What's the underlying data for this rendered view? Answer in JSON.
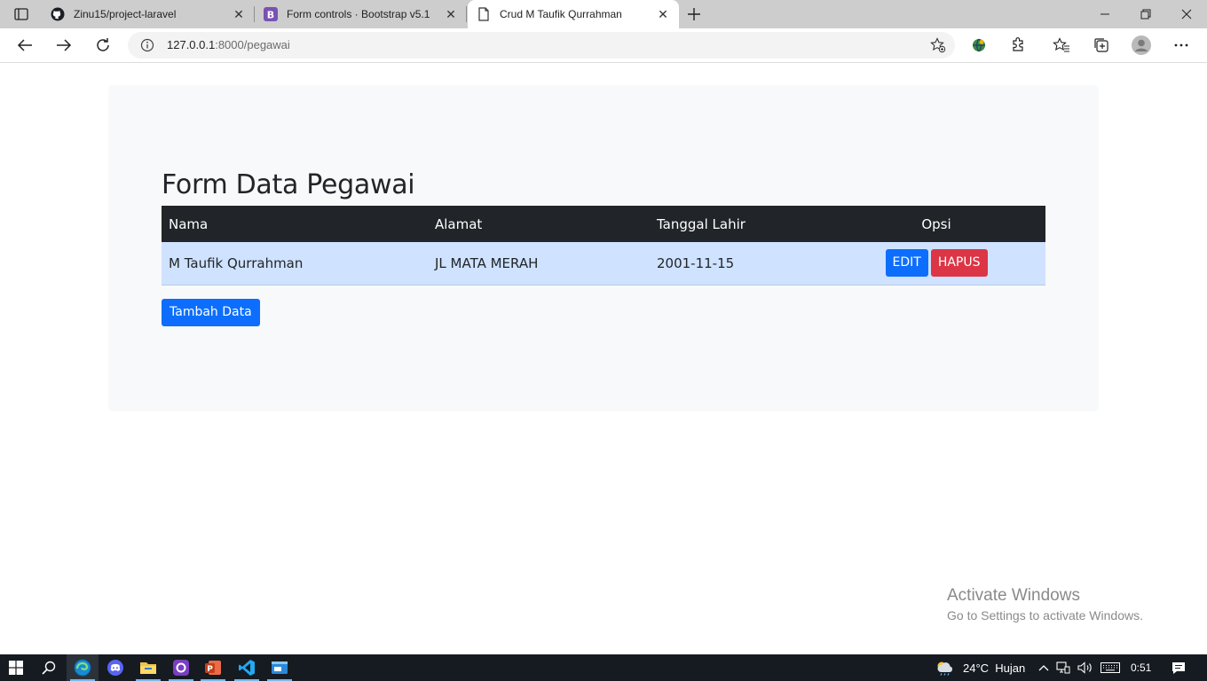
{
  "browser": {
    "tabs": [
      {
        "title": "Zinu15/project-laravel",
        "favicon": "github-icon"
      },
      {
        "title": "Form controls · Bootstrap v5.1",
        "favicon": "bootstrap-icon"
      },
      {
        "title": "Crud M Taufik Qurrahman",
        "favicon": "page-icon",
        "active": true
      }
    ],
    "address": {
      "host": "127.0.0.1",
      "path": ":8000/pegawai"
    }
  },
  "page": {
    "title": "Form Data Pegawai",
    "table": {
      "headers": [
        "Nama",
        "Alamat",
        "Tanggal Lahir",
        "Opsi"
      ],
      "rows": [
        {
          "nama": "M Taufik Qurrahman",
          "alamat": "JL MATA MERAH",
          "tanggal_lahir": "2001-11-15"
        }
      ],
      "edit_label": "EDIT",
      "delete_label": "HAPUS"
    },
    "add_button": "Tambah Data"
  },
  "watermark": {
    "line1": "Activate Windows",
    "line2": "Go to Settings to activate Windows."
  },
  "taskbar": {
    "weather": "24°C  Hujan",
    "time": "0:51"
  },
  "colors": {
    "primary": "#0d6efd",
    "danger": "#dc3545",
    "table_dark": "#212529",
    "row_primary": "#cfe2ff"
  }
}
